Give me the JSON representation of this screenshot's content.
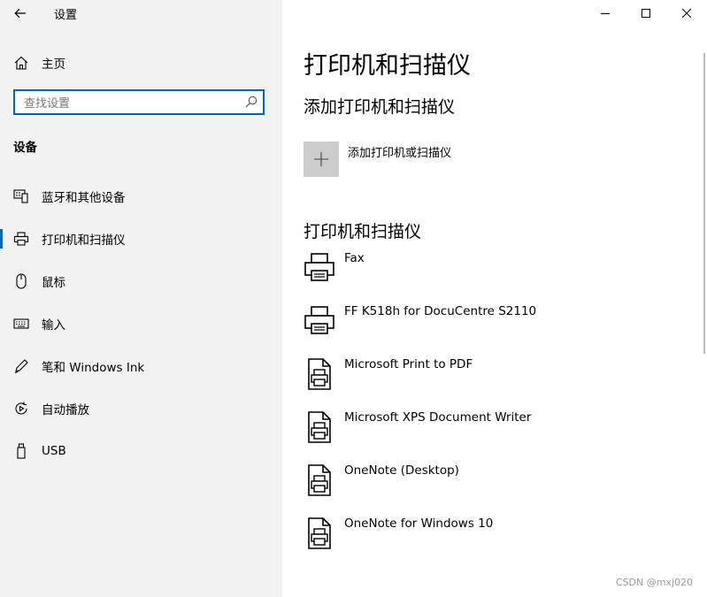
{
  "window": {
    "title": "设置"
  },
  "sidebar": {
    "home_label": "主页",
    "search_placeholder": "查找设置",
    "section_title": "设备",
    "items": [
      {
        "label": "蓝牙和其他设备",
        "icon": "bluetooth-devices-icon"
      },
      {
        "label": "打印机和扫描仪",
        "icon": "printer-icon",
        "active": true
      },
      {
        "label": "鼠标",
        "icon": "mouse-icon"
      },
      {
        "label": "输入",
        "icon": "keyboard-icon"
      },
      {
        "label": "笔和 Windows Ink",
        "icon": "pen-icon"
      },
      {
        "label": "自动播放",
        "icon": "autoplay-icon"
      },
      {
        "label": "USB",
        "icon": "usb-icon"
      }
    ]
  },
  "main": {
    "page_title": "打印机和扫描仪",
    "add_section_title": "添加打印机和扫描仪",
    "add_button_label": "添加打印机或扫描仪",
    "list_section_title": "打印机和扫描仪",
    "printers": [
      {
        "name": "Fax",
        "icon": "fax-icon"
      },
      {
        "name": "FF K518h for DocuCentre S2110",
        "icon": "printer-icon"
      },
      {
        "name": "Microsoft Print to PDF",
        "icon": "virtual-printer-icon"
      },
      {
        "name": "Microsoft XPS Document Writer",
        "icon": "virtual-printer-icon"
      },
      {
        "name": "OneNote (Desktop)",
        "icon": "virtual-printer-icon"
      },
      {
        "name": "OneNote for Windows 10",
        "icon": "virtual-printer-icon"
      }
    ]
  },
  "watermark": "CSDN @mxj020",
  "colors": {
    "accent": "#0067c0",
    "sidebar_bg": "#f2f2f2",
    "tile_bg": "#cccccc"
  }
}
